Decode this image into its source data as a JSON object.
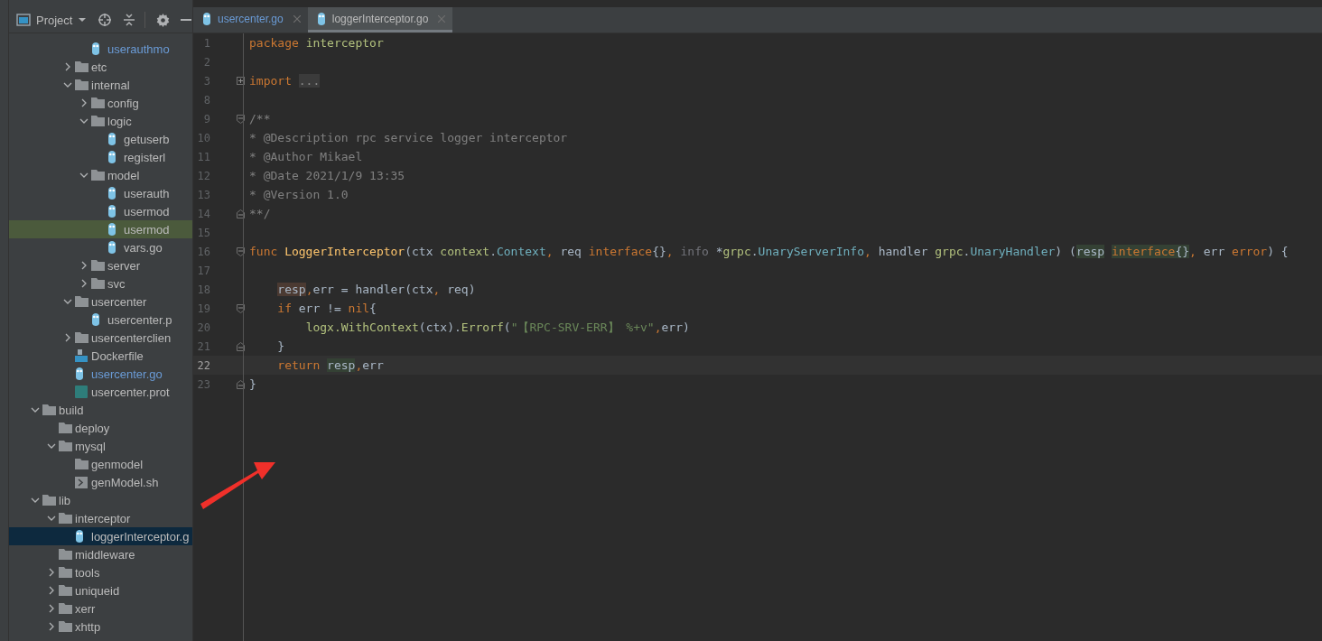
{
  "project_panel": {
    "title": "Project"
  },
  "tree": [
    {
      "children": [
        {
          "children": [
            {
              "children": [
                {
                  "label": "userauthmo",
                  "kind": "go",
                  "selected": false,
                  "highlighted": false,
                  "modified": true
                }
              ]
            },
            {
              "label": "etc",
              "kind": "folder",
              "expanded": false,
              "selected": false,
              "highlighted": false,
              "modified": false
            },
            {
              "label": "internal",
              "kind": "folder",
              "expanded": true,
              "selected": false,
              "highlighted": false,
              "modified": false,
              "children": [
                {
                  "label": "config",
                  "kind": "folder",
                  "expanded": false,
                  "selected": false,
                  "highlighted": false,
                  "modified": false
                },
                {
                  "label": "logic",
                  "kind": "folder",
                  "expanded": true,
                  "selected": false,
                  "highlighted": false,
                  "modified": false,
                  "children": [
                    {
                      "label": "getuserb",
                      "kind": "go",
                      "selected": false,
                      "highlighted": false,
                      "modified": false
                    },
                    {
                      "label": "registerl",
                      "kind": "go",
                      "selected": false,
                      "highlighted": false,
                      "modified": false
                    }
                  ]
                },
                {
                  "label": "model",
                  "kind": "folder",
                  "expanded": true,
                  "selected": false,
                  "highlighted": false,
                  "modified": false,
                  "children": [
                    {
                      "label": "userauth",
                      "kind": "go",
                      "selected": false,
                      "highlighted": false,
                      "modified": false
                    },
                    {
                      "label": "usermod",
                      "kind": "go",
                      "selected": false,
                      "highlighted": false,
                      "modified": false
                    },
                    {
                      "label": "usermod",
                      "kind": "go",
                      "selected": false,
                      "highlighted": true,
                      "modified": false
                    },
                    {
                      "label": "vars.go",
                      "kind": "go",
                      "selected": false,
                      "highlighted": false,
                      "modified": false
                    }
                  ]
                },
                {
                  "label": "server",
                  "kind": "folder",
                  "expanded": false,
                  "selected": false,
                  "highlighted": false,
                  "modified": false
                },
                {
                  "label": "svc",
                  "kind": "folder",
                  "expanded": false,
                  "selected": false,
                  "highlighted": false,
                  "modified": false
                }
              ]
            },
            {
              "label": "usercenter",
              "kind": "folder",
              "expanded": true,
              "selected": false,
              "highlighted": false,
              "modified": false,
              "children": [
                {
                  "label": "usercenter.p",
                  "kind": "go",
                  "selected": false,
                  "highlighted": false,
                  "modified": false
                }
              ]
            },
            {
              "label": "usercenterclien",
              "kind": "folder",
              "expanded": false,
              "selected": false,
              "highlighted": false,
              "modified": false
            },
            {
              "label": "Dockerfile",
              "kind": "docker",
              "selected": false,
              "highlighted": false,
              "modified": false
            },
            {
              "label": "usercenter.go",
              "kind": "go",
              "selected": false,
              "highlighted": false,
              "modified": true
            },
            {
              "label": "usercenter.prot",
              "kind": "proto",
              "selected": false,
              "highlighted": false,
              "modified": false
            }
          ]
        }
      ]
    },
    {
      "label": "build",
      "kind": "folder",
      "expanded": true,
      "selected": false,
      "highlighted": false,
      "modified": false,
      "children": [
        {
          "label": "deploy",
          "kind": "folder",
          "selected": false,
          "highlighted": false,
          "modified": false
        },
        {
          "label": "mysql",
          "kind": "folder",
          "expanded": true,
          "selected": false,
          "highlighted": false,
          "modified": false,
          "children": [
            {
              "label": "genmodel",
              "kind": "folder",
              "selected": false,
              "highlighted": false,
              "modified": false
            },
            {
              "label": "genModel.sh",
              "kind": "shell",
              "selected": false,
              "highlighted": false,
              "modified": false
            }
          ]
        }
      ]
    },
    {
      "label": "lib",
      "kind": "folder",
      "expanded": true,
      "selected": false,
      "highlighted": false,
      "modified": false,
      "children": [
        {
          "label": "interceptor",
          "kind": "folder",
          "expanded": true,
          "selected": false,
          "highlighted": false,
          "modified": false,
          "children": [
            {
              "label": "loggerInterceptor.g",
              "kind": "go",
              "selected": true,
              "highlighted": false,
              "modified": false
            }
          ]
        },
        {
          "label": "middleware",
          "kind": "folder",
          "selected": false,
          "highlighted": false,
          "modified": false
        },
        {
          "label": "tools",
          "kind": "folder",
          "expanded": false,
          "selected": false,
          "highlighted": false,
          "modified": false
        },
        {
          "label": "uniqueid",
          "kind": "folder",
          "expanded": false,
          "selected": false,
          "highlighted": false,
          "modified": false
        },
        {
          "label": "xerr",
          "kind": "folder",
          "expanded": false,
          "selected": false,
          "highlighted": false,
          "modified": false
        },
        {
          "label": "xhttp",
          "kind": "folder",
          "expanded": false,
          "selected": false,
          "highlighted": false,
          "modified": false
        }
      ]
    }
  ],
  "tabs": [
    {
      "label": "usercenter.go",
      "selected": false,
      "modified": true
    },
    {
      "label": "loggerInterceptor.go",
      "selected": true,
      "modified": false
    }
  ],
  "code_lines": [
    {
      "number": "1",
      "current": false,
      "kind": "plain",
      "tokens": [
        {
          "text": "package ",
          "kind": "kw"
        },
        {
          "text": "interceptor",
          "kind": "pkg"
        }
      ]
    },
    {
      "number": "2",
      "current": false,
      "kind": "plain"
    },
    {
      "number": "3",
      "current": false,
      "kind": "folded",
      "tokens": [
        {
          "text": "import ",
          "kind": "kw"
        },
        {
          "text": "...",
          "kind": "folded"
        }
      ]
    },
    {
      "number": "8",
      "current": false,
      "kind": "plain"
    },
    {
      "number": "9",
      "current": false,
      "kind": "fold_start",
      "tokens": [
        {
          "text": "/**",
          "kind": "comment"
        }
      ]
    },
    {
      "number": "10",
      "current": false,
      "kind": "plain",
      "tokens": [
        {
          "text": "* @Description rpc service logger interceptor",
          "kind": "comment"
        }
      ]
    },
    {
      "number": "11",
      "current": false,
      "kind": "plain",
      "tokens": [
        {
          "text": "* @Author Mikael",
          "kind": "comment"
        }
      ]
    },
    {
      "number": "12",
      "current": false,
      "kind": "plain",
      "tokens": [
        {
          "text": "* @Date 2021/1/9 13:35",
          "kind": "comment"
        }
      ]
    },
    {
      "number": "13",
      "current": false,
      "kind": "plain",
      "tokens": [
        {
          "text": "* @Version 1.0",
          "kind": "comment"
        }
      ]
    },
    {
      "number": "14",
      "current": false,
      "kind": "fold_end",
      "tokens": [
        {
          "text": "**/",
          "kind": "comment"
        }
      ]
    },
    {
      "number": "15",
      "current": false,
      "kind": "plain"
    },
    {
      "number": "16",
      "current": false,
      "kind": "fold_start",
      "tokens": [
        {
          "text": "func ",
          "kind": "kw"
        },
        {
          "text": "LoggerInterceptor",
          "kind": "fn"
        },
        {
          "text": "(ctx ",
          "kind": "plain"
        },
        {
          "text": "context",
          "kind": "pkg"
        },
        {
          "text": ".",
          "kind": "plain"
        },
        {
          "text": "Context",
          "kind": "type"
        },
        {
          "text": ", ",
          "kind": "punct"
        },
        {
          "text": "req ",
          "kind": "plain"
        },
        {
          "text": "interface",
          "kind": "kw"
        },
        {
          "text": "{}",
          "kind": "plain"
        },
        {
          "text": ", ",
          "kind": "punct"
        },
        {
          "text": "info",
          "kind": "param"
        },
        {
          "text": " *",
          "kind": "plain"
        },
        {
          "text": "grpc",
          "kind": "pkg"
        },
        {
          "text": ".",
          "kind": "plain"
        },
        {
          "text": "UnaryServerInfo",
          "kind": "type"
        },
        {
          "text": ", ",
          "kind": "punct"
        },
        {
          "text": "handler ",
          "kind": "plain"
        },
        {
          "text": "grpc",
          "kind": "pkg"
        },
        {
          "text": ".",
          "kind": "plain"
        },
        {
          "text": "UnaryHandler",
          "kind": "type"
        },
        {
          "text": ") (",
          "kind": "plain"
        },
        {
          "text": "resp",
          "kind": "plain_read"
        },
        {
          "text": " interface",
          "kind": "kw_read"
        },
        {
          "text": "{}",
          "kind": "plain_read"
        },
        {
          "text": ", ",
          "kind": "punct"
        },
        {
          "text": "err ",
          "kind": "plain"
        },
        {
          "text": "error",
          "kind": "kw"
        },
        {
          "text": ") {",
          "kind": "plain"
        }
      ]
    },
    {
      "number": "17",
      "current": false,
      "kind": "plain"
    },
    {
      "number": "18",
      "current": false,
      "kind": "plain",
      "tokens": [
        {
          "text": "    resp",
          "kind": "plain_write"
        },
        {
          "text": ",",
          "kind": "punct"
        },
        {
          "text": "err = handler(ctx",
          "kind": "plain"
        },
        {
          "text": ", ",
          "kind": "punct"
        },
        {
          "text": "req)",
          "kind": "plain"
        }
      ]
    },
    {
      "number": "19",
      "current": false,
      "kind": "fold_start",
      "tokens": [
        {
          "text": "    if ",
          "kind": "kw"
        },
        {
          "text": "err != ",
          "kind": "plain"
        },
        {
          "text": "nil",
          "kind": "kw"
        },
        {
          "text": "{",
          "kind": "plain"
        }
      ]
    },
    {
      "number": "20",
      "current": false,
      "kind": "plain",
      "tokens": [
        {
          "text": "        logx.WithContext",
          "kind": "pkg"
        },
        {
          "text": "(ctx).",
          "kind": "plain"
        },
        {
          "text": "Errorf",
          "kind": "pkg"
        },
        {
          "text": "(",
          "kind": "plain"
        },
        {
          "text": "\"【RPC-SRV-ERR】 %+v\"",
          "kind": "str"
        },
        {
          "text": ",err)",
          "kind": "sep"
        }
      ]
    },
    {
      "number": "21",
      "current": false,
      "kind": "fold_end",
      "tokens": [
        {
          "text": "    }",
          "kind": "plain"
        }
      ]
    },
    {
      "number": "22",
      "current": true,
      "kind": "plain",
      "tokens": [
        {
          "text": "    return ",
          "kind": "kw"
        },
        {
          "text": "resp",
          "kind": "plain_read"
        },
        {
          "text": ",",
          "kind": "punct"
        },
        {
          "text": "err",
          "kind": "plain"
        }
      ]
    },
    {
      "number": "23",
      "current": false,
      "kind": "fold_end",
      "tokens": [
        {
          "text": "}",
          "kind": "plain"
        }
      ]
    }
  ]
}
